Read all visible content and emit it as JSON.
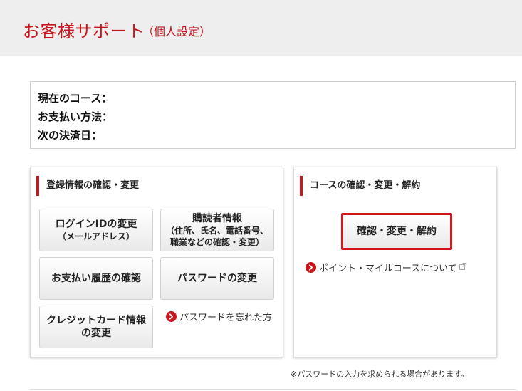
{
  "header": {
    "title": "お客様サポート",
    "subtitle": "（個人設定）"
  },
  "info": {
    "current_course_label": "現在のコース：",
    "payment_method_label": "お支払い方法：",
    "next_payment_label": "次の決済日："
  },
  "registration": {
    "heading": "登録情報の確認・変更",
    "login_id_button": {
      "line1": "ログインIDの変更",
      "line2": "（メールアドレス）"
    },
    "reader_info_button": {
      "line1": "購読者情報",
      "line2": "（住所、氏名、電話番号、",
      "line3": "職業などの確認・変更）"
    },
    "payment_history_button": "お支払い履歴の確認",
    "password_change_button": "パスワードの変更",
    "credit_card_button": {
      "line1": "クレジットカード情報",
      "line2": "の変更"
    },
    "forgot_password_link": "パスワードを忘れた方"
  },
  "course": {
    "heading": "コースの確認・変更・解約",
    "manage_button": "確認・変更・解約",
    "point_mile_link": "ポイント・マイルコースについて"
  },
  "note": "※パスワードの入力を求められる場合があります。",
  "colors": {
    "accent": "#c8161d",
    "header_bg": "#eeeeee"
  },
  "icons": {
    "link_arrow": "chevron-right-circle-icon",
    "external": "external-link-icon"
  }
}
